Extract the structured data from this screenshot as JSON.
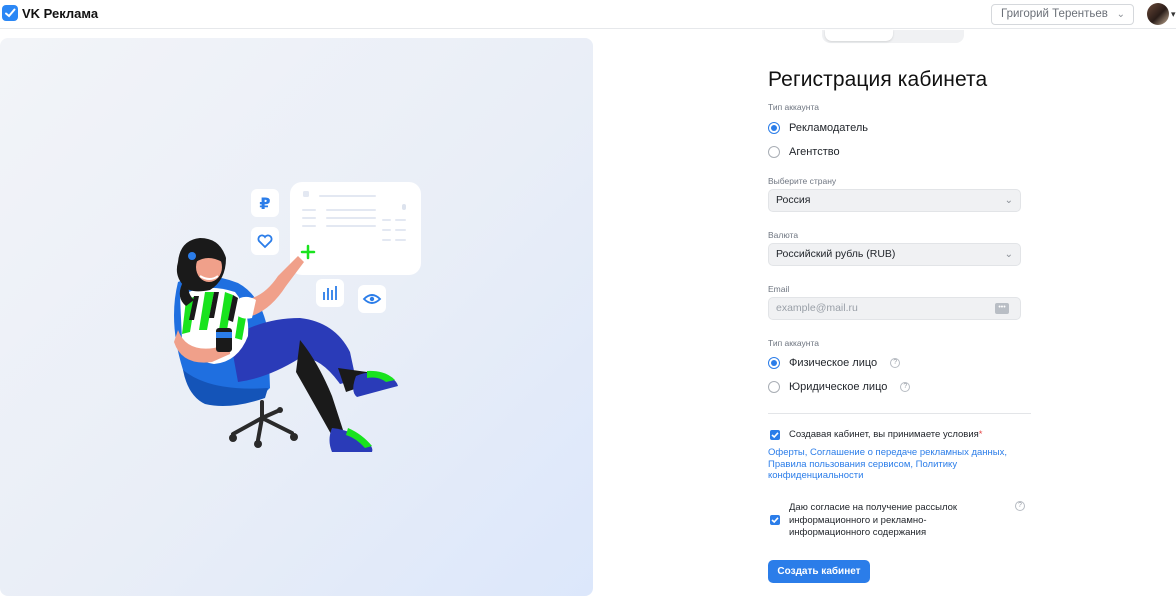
{
  "header": {
    "brand": "VK Реклама",
    "user_name": "Григорий Терентьев"
  },
  "form": {
    "title": "Регистрация кабинета",
    "account_type_label": "Тип аккаунта",
    "account_type_options": [
      "Рекламодатель",
      "Агентство"
    ],
    "account_type_selected": "Рекламодатель",
    "country_label": "Выберите страну",
    "country_value": "Россия",
    "currency_label": "Валюта",
    "currency_value": "Российский рубль (RUB)",
    "email_label": "Email",
    "email_placeholder": "example@mail.ru",
    "person_type_label": "Тип аккаунта",
    "person_type_options": [
      "Физическое лицо",
      "Юридическое лицо"
    ],
    "person_type_selected": "Физическое лицо",
    "terms_text": "Создавая кабинет, вы принимаете условия",
    "terms_required_mark": "*",
    "terms_links": "Оферты, Соглашение о передаче рекламных данных, Правила пользования сервисом, Политику конфиденциальности",
    "terms_checked": true,
    "consent_text_1": "Даю согласие на получение рассылок",
    "consent_text_2": "информационного и рекламно-",
    "consent_text_3": "информационного содержания",
    "consent_checked": true,
    "submit_label": "Создать кабинет"
  },
  "illustration": {
    "currency_symbol": "₽"
  },
  "colors": {
    "accent": "#2b7de9",
    "chair": "#1f6fe0",
    "pants": "#2a3bb8",
    "green": "#19e31e"
  },
  "icons": [
    "vk-ads-logo-icon",
    "chevron-down-icon",
    "user-avatar",
    "ruble-icon",
    "heart-icon",
    "bar-chart-icon",
    "eye-icon",
    "help-icon",
    "checkmark-icon",
    "autofill-icon"
  ]
}
